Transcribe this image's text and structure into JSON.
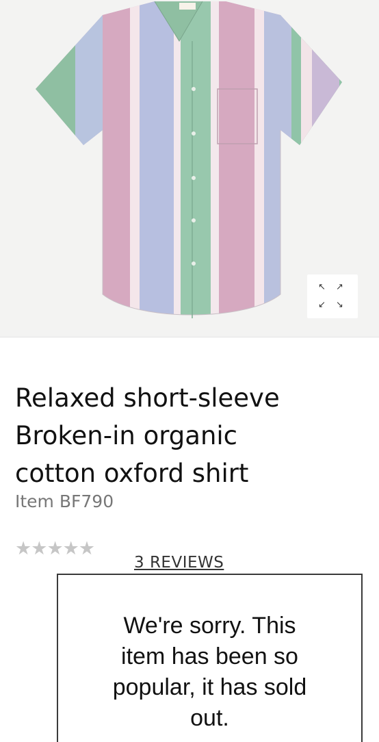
{
  "product": {
    "image": {
      "alt_subject": "shirt",
      "expand_icon": "expand-arrows-icon",
      "stripe_colors": [
        "#d9b3c6",
        "#b9c1de",
        "#9fc6ac",
        "#f2e4e6"
      ]
    },
    "title_lines": [
      "Relaxed short-sleeve",
      "Broken-in organic",
      "cotton oxford shirt"
    ],
    "item_code": "Item BF790",
    "rating": {
      "stars_filled": 0,
      "stars_total": 5,
      "star_icon": "star-icon"
    },
    "reviews_link": "3 REVIEWS",
    "sold_out_message_lines": [
      "We're sorry. This",
      "item has been so",
      "popular, it has sold",
      "out."
    ]
  },
  "icons": {
    "arrow_nw": "↖",
    "arrow_ne": "↗",
    "arrow_sw": "↙",
    "arrow_se": "↘"
  },
  "colors": {
    "star_empty": "#c6c6c6",
    "item_code_gray": "#777777",
    "box_border": "#3a3a3a"
  }
}
